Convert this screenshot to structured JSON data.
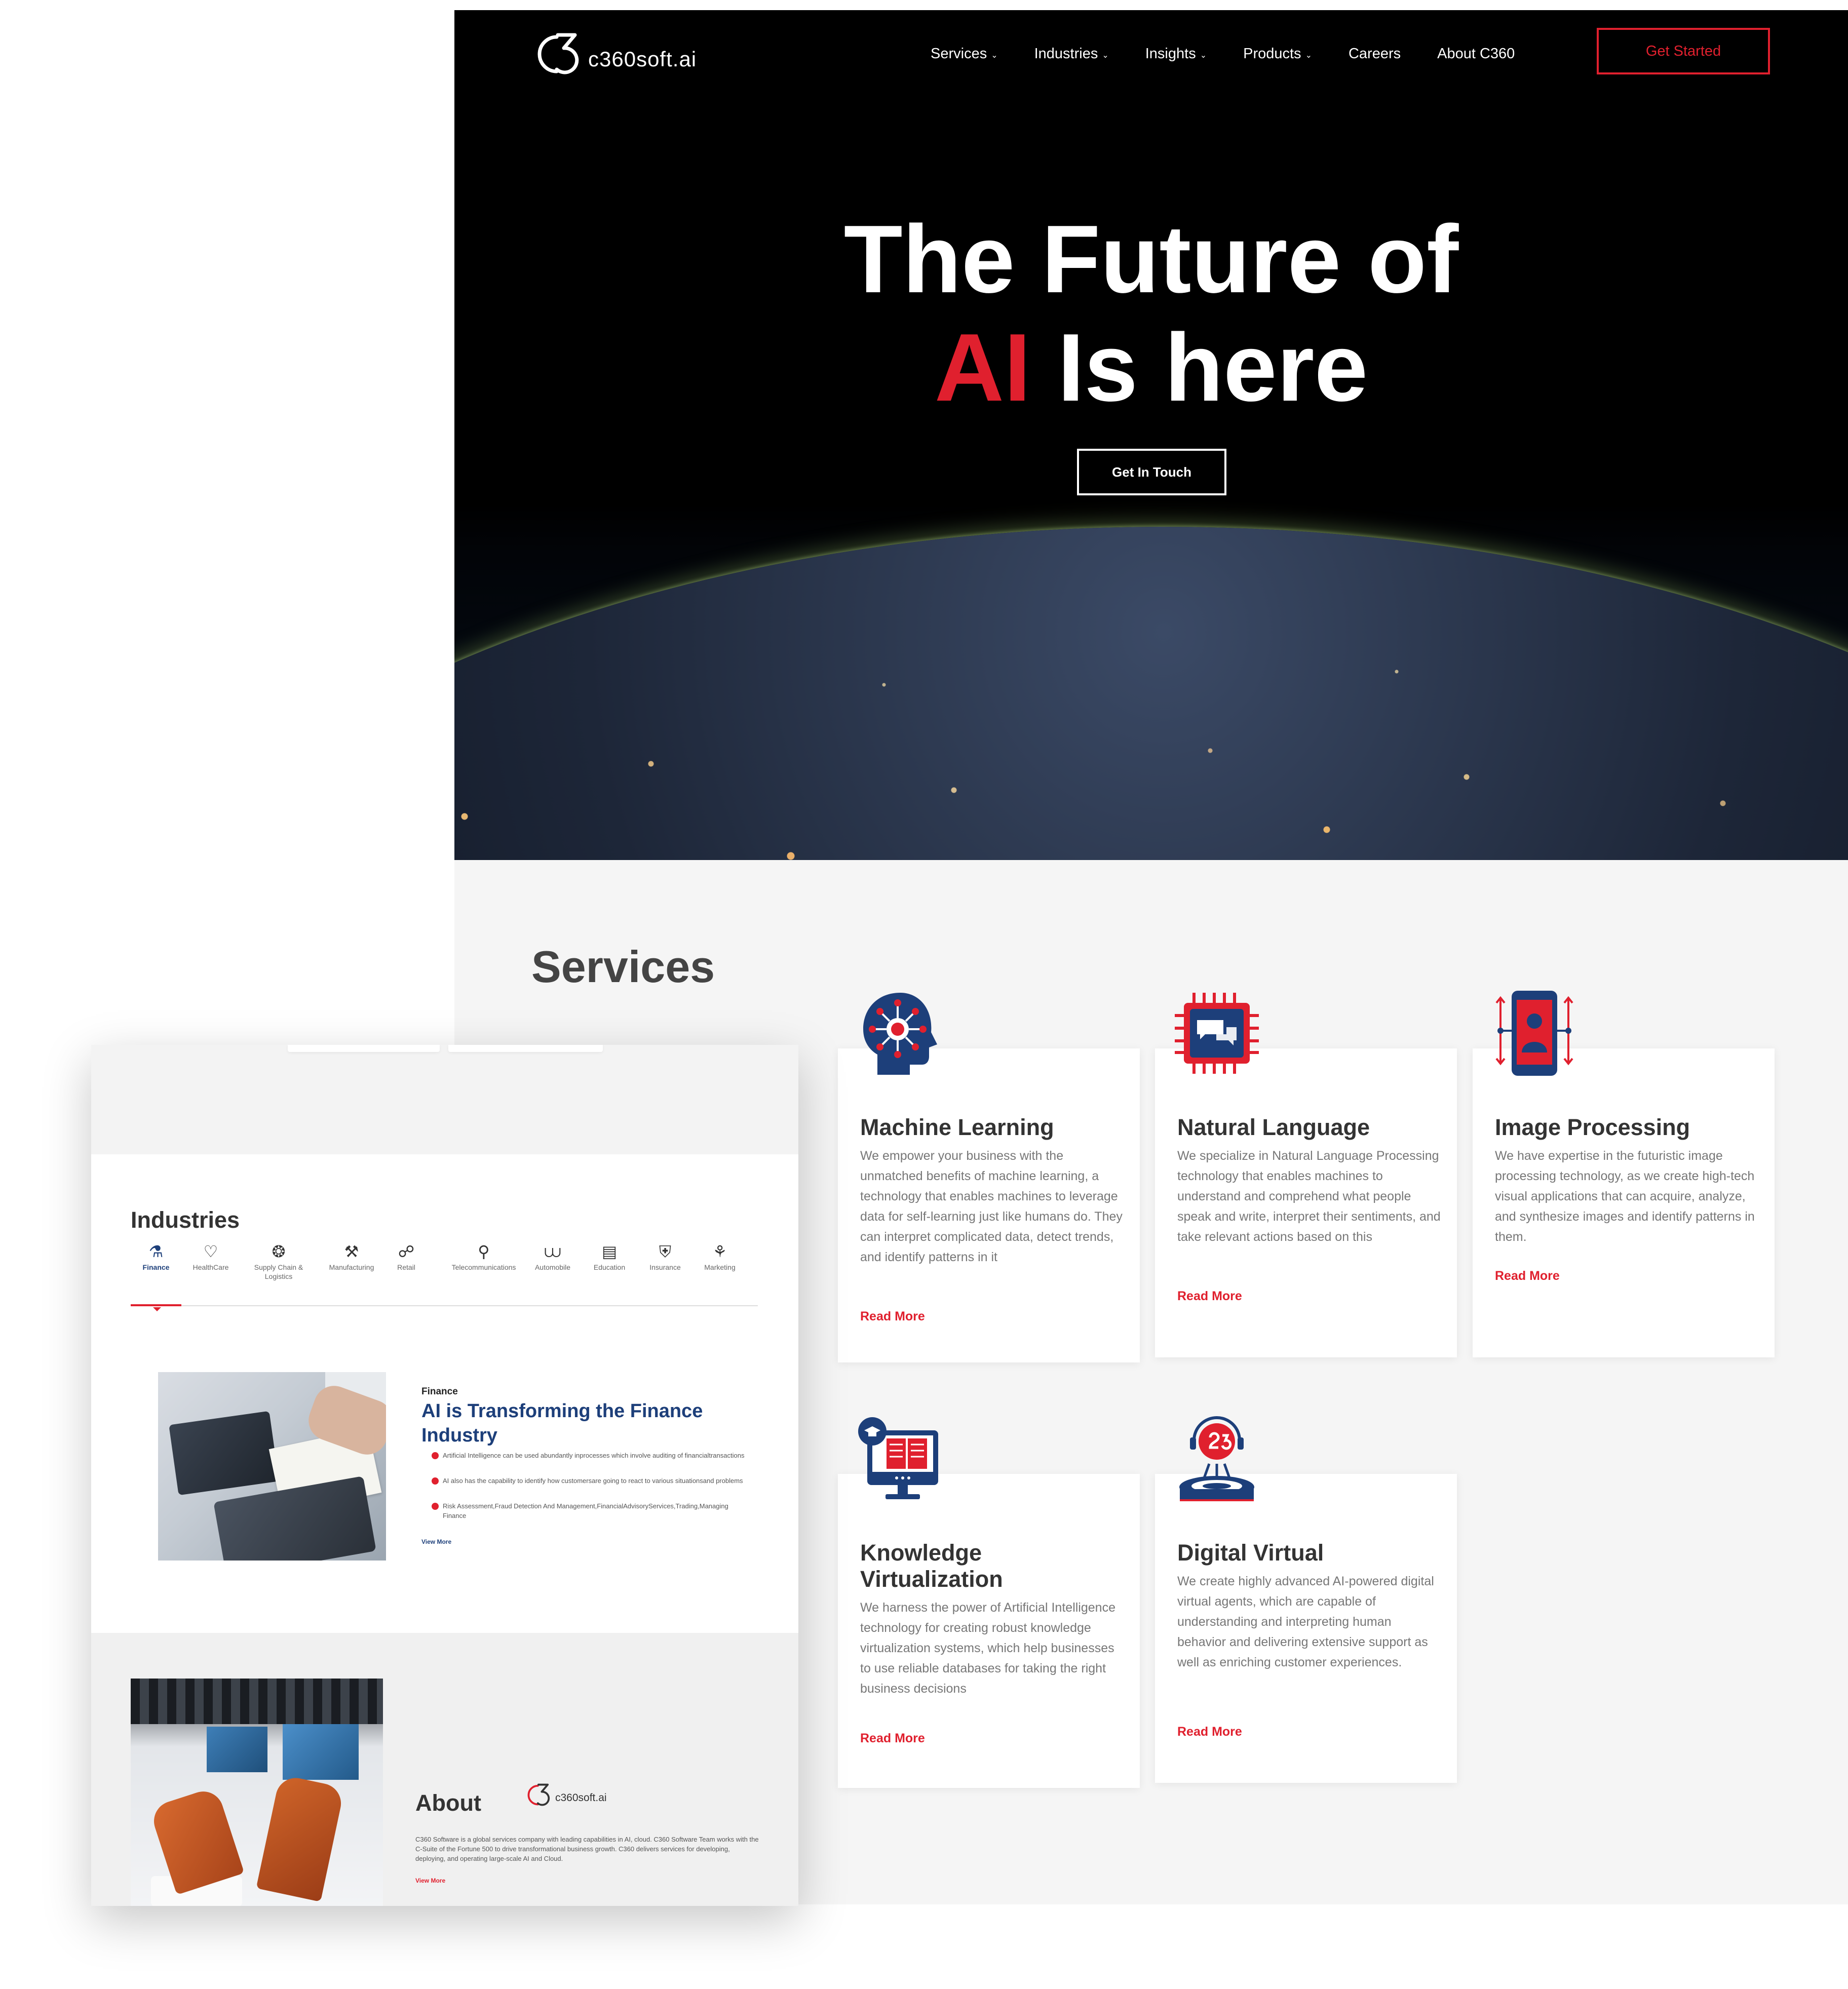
{
  "header": {
    "logo_text": "c360soft.ai",
    "nav": [
      "Services",
      "Industries",
      "Insights",
      "Products",
      "Careers",
      "About C360"
    ],
    "cta": "Get Started"
  },
  "hero": {
    "title_line1": "The Future of",
    "title_highlight": "AI",
    "title_line2_rest": " Is here",
    "button": "Get In Touch"
  },
  "services": {
    "heading": "Services",
    "read_more": "Read More",
    "items": [
      {
        "title": "Machine Learning",
        "icon": "brain-network-icon",
        "desc": "We empower your business with the unmatched benefits of machine learning, a technology that enables machines to leverage data for self-learning just like humans do. They can interpret complicated data, detect trends, and identify patterns in it"
      },
      {
        "title": "Natural Language",
        "icon": "chip-chat-icon",
        "desc": "We specialize in Natural Language Processing technology that enables machines to understand and comprehend what people speak and write, interpret their sentiments, and take relevant actions based on this"
      },
      {
        "title": "Image Processing",
        "icon": "phone-scan-icon",
        "desc": "We have expertise in the futuristic image processing technology, as we create high-tech visual applications that can acquire, analyze, and synthesize images and identify patterns in them."
      },
      {
        "title": "Knowledge Virtualization",
        "icon": "monitor-book-icon",
        "desc": "We harness the power of Artificial Intelligence technology for creating robust knowledge virtualization systems, which help businesses to use reliable databases for taking the right business decisions"
      },
      {
        "title": "Digital Virtual",
        "icon": "virtual-agent-icon",
        "desc": "We create highly advanced AI-powered digital virtual agents, which are capable of understanding and interpreting human behavior and delivering extensive support as well as enriching customer experiences."
      }
    ]
  },
  "industries": {
    "heading": "Industries",
    "tabs": [
      {
        "label": "Finance",
        "icon": "finance-icon"
      },
      {
        "label": "HealthCare",
        "icon": "heart-icon"
      },
      {
        "label": "Supply Chain & Logistics",
        "icon": "supply-chain-icon"
      },
      {
        "label": "Manufacturing",
        "icon": "factory-icon"
      },
      {
        "label": "Retail",
        "icon": "cart-icon"
      },
      {
        "label": "Telecommunications",
        "icon": "tower-icon"
      },
      {
        "label": "Automobile",
        "icon": "car-icon"
      },
      {
        "label": "Education",
        "icon": "school-icon"
      },
      {
        "label": "Insurance",
        "icon": "shield-icon"
      },
      {
        "label": "Marketing",
        "icon": "megaphone-icon"
      }
    ],
    "active_tab": "Finance",
    "panel": {
      "kicker": "Finance",
      "title": "AI is Transforming the Finance Industry",
      "bullets": [
        "Artificial Intelligence can be used abundantly inprocesses which involve auditing of financialtransactions",
        "AI also has the capability to identify how customersare going to react to various situationsand problems",
        "Risk Assessment,Fraud Detection And Management,FinancialAdvisoryServices,Trading,Managing Finance"
      ],
      "view_more": "View More"
    }
  },
  "about": {
    "heading": "About",
    "logo_text": "c360soft.ai",
    "desc": "C360 Software is a global services company with leading capabilities in AI, cloud. C360 Software Team works with the C-Suite of the Fortune 500 to drive transformational business growth. C360 delivers services for developing, deploying, and operating large-scale AI and Cloud.",
    "view_more": "View More"
  },
  "colors": {
    "accent": "#e0202e",
    "navy": "#1d3f7a",
    "hero_bg": "#000000",
    "section_bg": "#f5f5f5"
  }
}
